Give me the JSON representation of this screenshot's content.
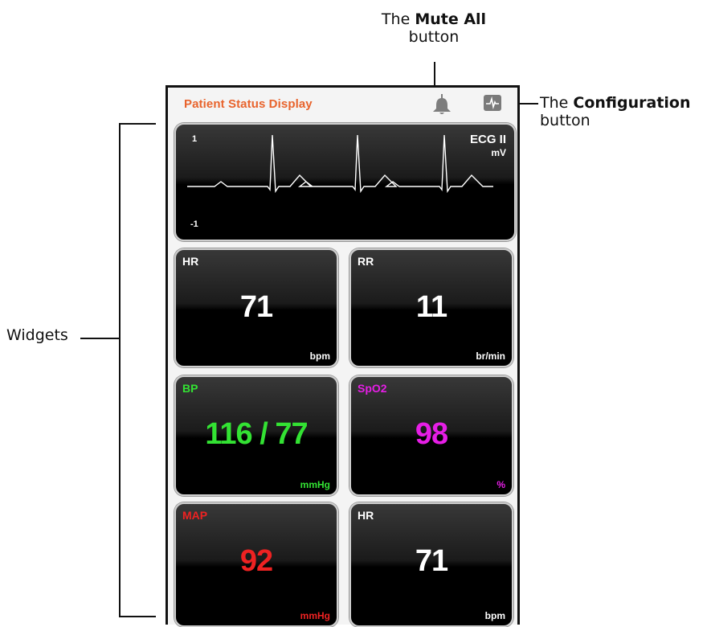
{
  "annotations": {
    "mute_pre": "The ",
    "mute_bold": "Mute All",
    "mute_post": "button",
    "config_pre": "The ",
    "config_bold": "Configuration",
    "config_post": "button",
    "widgets": "Widgets"
  },
  "app": {
    "title": "Patient Status Display",
    "title_color": "#e8632c",
    "mute_icon": "bell-icon",
    "config_icon": "waveform-icon"
  },
  "ecg": {
    "title": "ECG II",
    "unit": "mV",
    "max_label": "1",
    "min_label": "-1",
    "color": "#ffffff"
  },
  "widgets": {
    "hr1": {
      "label": "HR",
      "value": "71",
      "unit": "bpm",
      "color": "#ffffff"
    },
    "rr": {
      "label": "RR",
      "value": "11",
      "unit": "br/min",
      "color": "#ffffff"
    },
    "bp": {
      "label": "BP",
      "value": "116 / 77",
      "unit": "mmHg",
      "color": "#33e233"
    },
    "spo2": {
      "label": "SpO2",
      "value": "98",
      "unit": "%",
      "color": "#e61ee6"
    },
    "map": {
      "label": "MAP",
      "value": "92",
      "unit": "mmHg",
      "color": "#ee2222"
    },
    "hr2": {
      "label": "HR",
      "value": "71",
      "unit": "bpm",
      "color": "#ffffff"
    }
  }
}
